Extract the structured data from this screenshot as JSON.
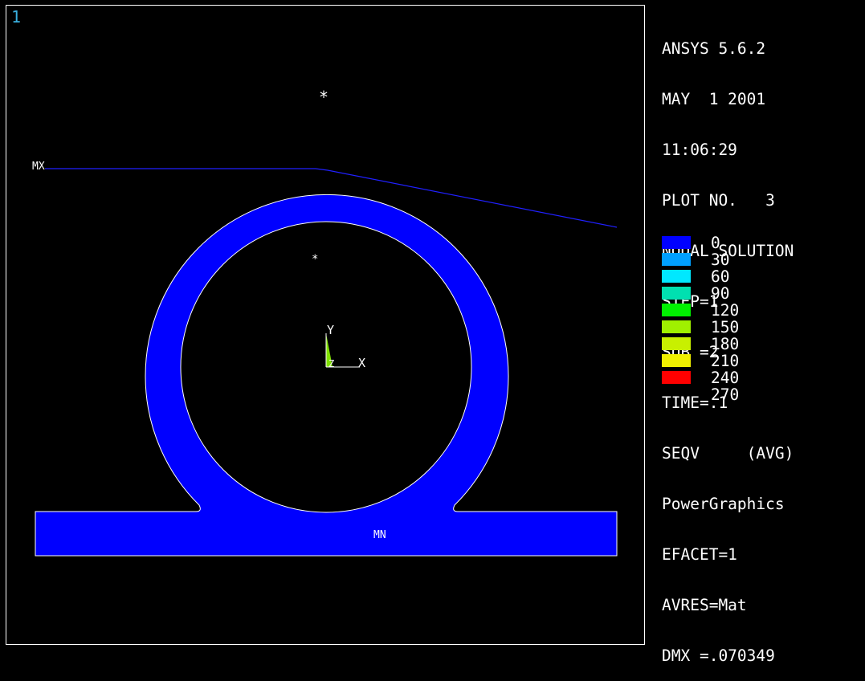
{
  "window": {
    "number": "1"
  },
  "info": {
    "lines": [
      "ANSYS 5.6.2",
      "MAY  1 2001",
      "11:06:29",
      "PLOT NO.   3",
      "NODAL SOLUTION",
      "STEP=1",
      "SUB =2",
      "TIME=.1",
      "SEQV     (AVG)",
      "PowerGraphics",
      "EFACET=1",
      "AVRES=Mat",
      "DMX =.070349"
    ]
  },
  "legend": {
    "entries": [
      {
        "value": "0",
        "color": "#0000ff"
      },
      {
        "value": "30",
        "color": "#00a0ff"
      },
      {
        "value": "60",
        "color": "#00e8ff"
      },
      {
        "value": "90",
        "color": "#00e0b0"
      },
      {
        "value": "120",
        "color": "#00f000"
      },
      {
        "value": "150",
        "color": "#a0f000"
      },
      {
        "value": "180",
        "color": "#c8f000"
      },
      {
        "value": "210",
        "color": "#f0f000"
      },
      {
        "value": "240",
        "color": "#ff0000"
      },
      {
        "value": "270",
        "color": ""
      }
    ]
  },
  "plot": {
    "max_label": "MX",
    "min_label": "MN",
    "axis_y_label": "Y",
    "axis_x_label": "X",
    "axis_z_label": "Z",
    "star_label": "*",
    "fill_color": "#0000ff",
    "edge_color": "#ffffff",
    "deform_line_color": "#2020ff",
    "triad_color": "#80e000"
  }
}
